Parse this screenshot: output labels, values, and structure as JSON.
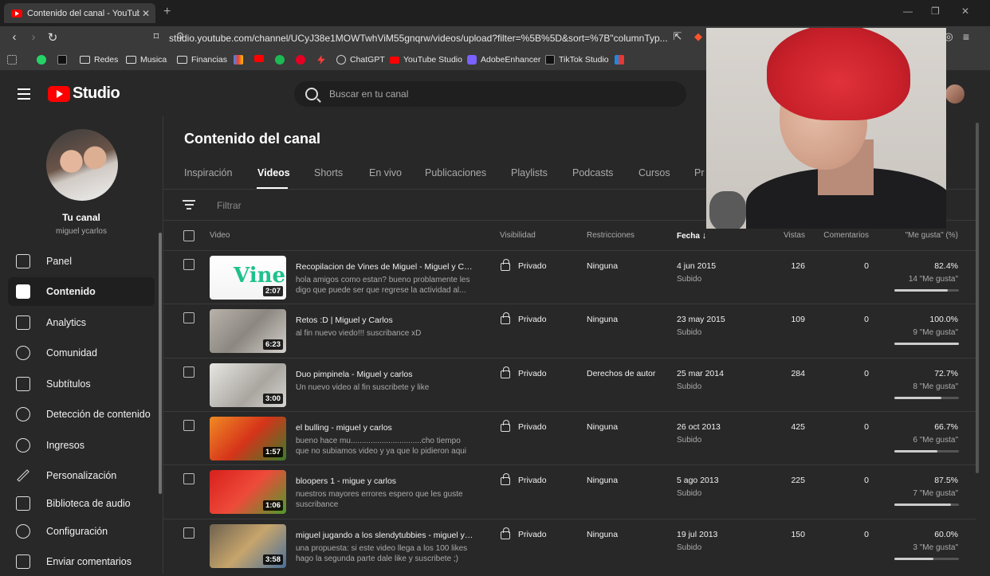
{
  "browser": {
    "tab_title": "Contenido del canal - YouTube Studio",
    "tab_close": "✕",
    "new_tab": "+",
    "window_controls": [
      "—",
      "❐",
      "✕"
    ],
    "url": "studio.youtube.com/channel/UCyJ38e1MOWTwhViM55gnqrw/videos/upload?filter=%5B%5D&sort=%7B\"columnTyp..."
  },
  "bookmarks": [
    {
      "label": "",
      "icon": "whatsapp-icon",
      "color": "#25d366"
    },
    {
      "label": "",
      "icon": "tiktok-icon",
      "color": "#ffffff"
    },
    {
      "label": "Redes",
      "icon": "folder-icon"
    },
    {
      "label": "Musica",
      "icon": "folder-icon"
    },
    {
      "label": "Financias",
      "icon": "folder-icon"
    },
    {
      "label": "",
      "icon": "gmail-icon",
      "color": "#ea4335"
    },
    {
      "label": "",
      "icon": "youtube-icon",
      "color": "#ff0000"
    },
    {
      "label": "",
      "icon": "spotify-icon",
      "color": "#1db954"
    },
    {
      "label": "",
      "icon": "pinterest-icon",
      "color": "#e60023"
    },
    {
      "label": "",
      "icon": "bolt-icon",
      "color": "#ff3b3b"
    },
    {
      "label": "ChatGPT",
      "icon": "chatgpt-icon",
      "color": "#cccccc"
    },
    {
      "label": "YouTube Studio",
      "icon": "youtube-icon",
      "color": "#ff0000"
    },
    {
      "label": "AdobeEnhancer",
      "icon": "adobe-icon",
      "color": "#7b61ff"
    },
    {
      "label": "TikTok Studio",
      "icon": "tiktok-icon",
      "color": "#ffffff"
    },
    {
      "label": "",
      "icon": "flag-icon",
      "color": "#e53935"
    }
  ],
  "header": {
    "logo_text": "Studio",
    "search_placeholder": "Buscar en tu canal"
  },
  "sidebar": {
    "channel_name": "Tu canal",
    "channel_handle": "miguel ycarlos",
    "items": [
      {
        "label": "Panel",
        "icon": "dashboard-icon",
        "active": false
      },
      {
        "label": "Contenido",
        "icon": "content-icon",
        "active": true
      },
      {
        "label": "Analytics",
        "icon": "analytics-icon",
        "active": false
      },
      {
        "label": "Comunidad",
        "icon": "community-icon",
        "active": false
      },
      {
        "label": "Subtítulos",
        "icon": "subtitles-icon",
        "active": false
      },
      {
        "label": "Detección de contenido",
        "icon": "copyright-icon",
        "active": false
      },
      {
        "label": "Ingresos",
        "icon": "dollar-icon",
        "active": false
      },
      {
        "label": "Personalización",
        "icon": "magic-wand-icon",
        "active": false
      },
      {
        "label": "Biblioteca de audio",
        "icon": "audio-library-icon",
        "active": false
      }
    ],
    "footer": [
      {
        "label": "Configuración",
        "icon": "gear-icon"
      },
      {
        "label": "Enviar comentarios",
        "icon": "feedback-icon"
      }
    ]
  },
  "main": {
    "title": "Contenido del canal",
    "tabs": [
      "Inspiración",
      "Videos",
      "Shorts",
      "En vivo",
      "Publicaciones",
      "Playlists",
      "Podcasts",
      "Cursos",
      "Pr"
    ],
    "active_tab": "Videos",
    "filter_placeholder": "Filtrar",
    "columns": {
      "video": "Video",
      "visibility": "Visibilidad",
      "restrictions": "Restricciones",
      "date": "Fecha",
      "views": "Vistas",
      "comments": "Comentarios",
      "likes": "\"Me gusta\" (%)"
    },
    "rows": [
      {
        "title": "Recopilacion de Vines de Miguel - Miguel y Carlos",
        "desc": "hola amigos como estan? bueno problamente les digo que puede ser que regrese la actividad al...",
        "duration": "2:07",
        "visibility": "Privado",
        "restriction": "Ninguna",
        "date": "4 jun 2015",
        "status": "Subido",
        "views": "126",
        "comments": "0",
        "likes_pct": "82.4%",
        "likes_count": "14 \"Me gusta\"",
        "likes_ratio": 0.824,
        "thumb": "vine"
      },
      {
        "title": "Retos :D | Miguel y Carlos",
        "desc": "al fin nuevo viedo!!! suscribance xD",
        "duration": "6:23",
        "visibility": "Privado",
        "restriction": "Ninguna",
        "date": "23 may 2015",
        "status": "Subido",
        "views": "109",
        "comments": "0",
        "likes_pct": "100.0%",
        "likes_count": "9 \"Me gusta\"",
        "likes_ratio": 1.0,
        "thumb": "room"
      },
      {
        "title": "Duo pimpinela - Miguel y carlos",
        "desc": "Un nuevo video al fin suscribete y like",
        "duration": "3:00",
        "visibility": "Privado",
        "restriction": "Derechos de autor",
        "date": "25 mar 2014",
        "status": "Subido",
        "views": "284",
        "comments": "0",
        "likes_pct": "72.7%",
        "likes_count": "8 \"Me gusta\"",
        "likes_ratio": 0.727,
        "thumb": "duo"
      },
      {
        "title": "el bulling - miguel y carlos",
        "desc": "bueno hace mu................................cho tiempo que no subiamos video y ya que lo pidieron aqui lo...",
        "duration": "1:57",
        "visibility": "Privado",
        "restriction": "Ninguna",
        "date": "26 oct 2013",
        "status": "Subido",
        "views": "425",
        "comments": "0",
        "likes_pct": "66.7%",
        "likes_count": "6 \"Me gusta\"",
        "likes_ratio": 0.667,
        "thumb": "orange"
      },
      {
        "title": "bloopers 1 - migue y carlos",
        "desc": "nuestros mayores errores espero que les guste suscribance",
        "duration": "1:06",
        "visibility": "Privado",
        "restriction": "Ninguna",
        "date": "5 ago 2013",
        "status": "Subido",
        "views": "225",
        "comments": "0",
        "likes_pct": "87.5%",
        "likes_count": "7 \"Me gusta\"",
        "likes_ratio": 0.875,
        "thumb": "red"
      },
      {
        "title": "miguel jugando a los slendytubbies - miguel y carlos",
        "desc": "una propuesta: si este video llega a los 100 likes hago la segunda parte dale like y suscribete ;)",
        "duration": "3:58",
        "visibility": "Privado",
        "restriction": "Ninguna",
        "date": "19 jul 2013",
        "status": "Subido",
        "views": "150",
        "comments": "0",
        "likes_pct": "60.0%",
        "likes_count": "3 \"Me gusta\"",
        "likes_ratio": 0.6,
        "thumb": "game"
      }
    ]
  },
  "colors": {
    "youtube_red": "#ff0000",
    "background": "#282828",
    "browser_bar": "#3a3a3a"
  }
}
